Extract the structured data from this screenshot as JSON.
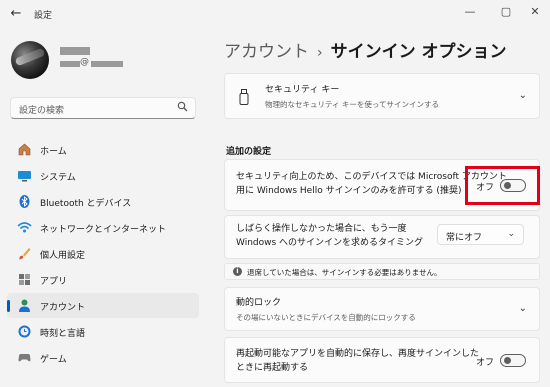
{
  "window": {
    "title": "設定",
    "minimize": "—",
    "maximize": "▢",
    "close": "✕"
  },
  "profile": {
    "at_sign": "@"
  },
  "search": {
    "placeholder": "設定の検索"
  },
  "nav": [
    {
      "label": "ホーム",
      "icon": "home-icon",
      "active": false
    },
    {
      "label": "システム",
      "icon": "system-icon",
      "active": false
    },
    {
      "label": "Bluetooth とデバイス",
      "icon": "bluetooth-icon",
      "active": false
    },
    {
      "label": "ネットワークとインターネット",
      "icon": "wifi-icon",
      "active": false
    },
    {
      "label": "個人用設定",
      "icon": "brush-icon",
      "active": false
    },
    {
      "label": "アプリ",
      "icon": "apps-icon",
      "active": false
    },
    {
      "label": "アカウント",
      "icon": "account-icon",
      "active": true
    },
    {
      "label": "時刻と言語",
      "icon": "clock-language-icon",
      "active": false
    },
    {
      "label": "ゲーム",
      "icon": "game-icon",
      "active": false
    }
  ],
  "header": {
    "parent": "アカウント",
    "separator": "›",
    "current": "サインイン オプション"
  },
  "security_key": {
    "title": "セキュリティ キー",
    "subtitle": "物理的なセキュリティ キーを使ってサインインする"
  },
  "additional": {
    "section_title": "追加の設定",
    "hello_only": {
      "line1": "セキュリティ向上のため、このデバイスでは Microsoft アカウント",
      "line2": "用に Windows Hello サインインのみを許可する (推奨)",
      "state_label": "オフ",
      "on": false
    },
    "away_signin": {
      "line1": "しばらく操作しなかった場合に、もう一度",
      "line2": "Windows へのサインインを求めるタイミング",
      "selected": "常にオフ"
    },
    "info_text": "退席していた場合は、サインインする必要はありません。",
    "dynamic_lock": {
      "title": "動的ロック",
      "subtitle": "その場にいないときにデバイスを自動的にロックする"
    },
    "restart_apps": {
      "line1": "再起動可能なアプリを自動的に保存し、再度サインインした",
      "line2": "ときに再起動する",
      "state_label": "オフ",
      "on": false
    }
  },
  "colors": {
    "accent": "#005fb8",
    "highlight_border": "#e0001b"
  }
}
